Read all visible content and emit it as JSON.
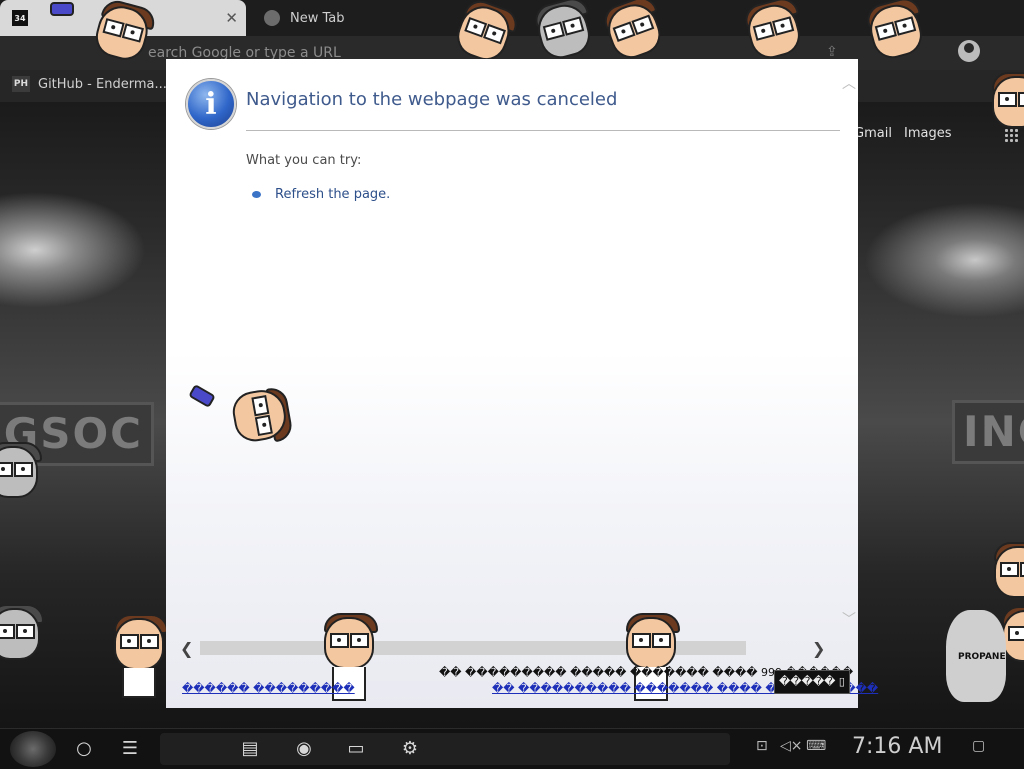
{
  "browser": {
    "tabs": [
      {
        "label": "",
        "favicon": "34",
        "active": true
      },
      {
        "label": "New Tab",
        "favicon": "chrome-icon",
        "active": false
      }
    ],
    "close_glyph": "✕",
    "omnibox_placeholder": "earch Google or type a URL",
    "bookmark": {
      "label": "GitHub - Enderma...",
      "favicon": "PH"
    },
    "google_links": {
      "gmail": "Gmail",
      "images": "Images"
    }
  },
  "background": {
    "sign_left": "GSOC",
    "sign_right": "INC"
  },
  "error_dialog": {
    "title": "Navigation to the webpage was canceled",
    "try_label": "What you can try:",
    "suggestion": "Refresh the page.",
    "icon_glyph": "i",
    "garbled_line_1": "�� ��������� ����� ������� ���� 999 ������",
    "garbled_link_2": "�� ���������� ������� ���� ����������",
    "garbled_link_left": "������ ���������",
    "button_label": "����� ▯",
    "scroll_left": "❮",
    "scroll_right": "❯",
    "scroll_up": "︿",
    "scroll_down": "﹀"
  },
  "decor": {
    "dog_label": "PROPANE"
  },
  "taskbar": {
    "time": "7:16 AM",
    "icons": [
      "start-orb-icon",
      "circle-search-icon",
      "task-view-icon",
      "notes-icon",
      "browser-icon",
      "folder-icon",
      "settings-icon",
      "network-icon",
      "volume-muted-icon",
      "keyboard-icon",
      "notification-icon"
    ]
  },
  "colors": {
    "title_blue": "#3f5a8c",
    "link_blue": "#1d2fb8",
    "info_blue": "#2f66c9"
  }
}
